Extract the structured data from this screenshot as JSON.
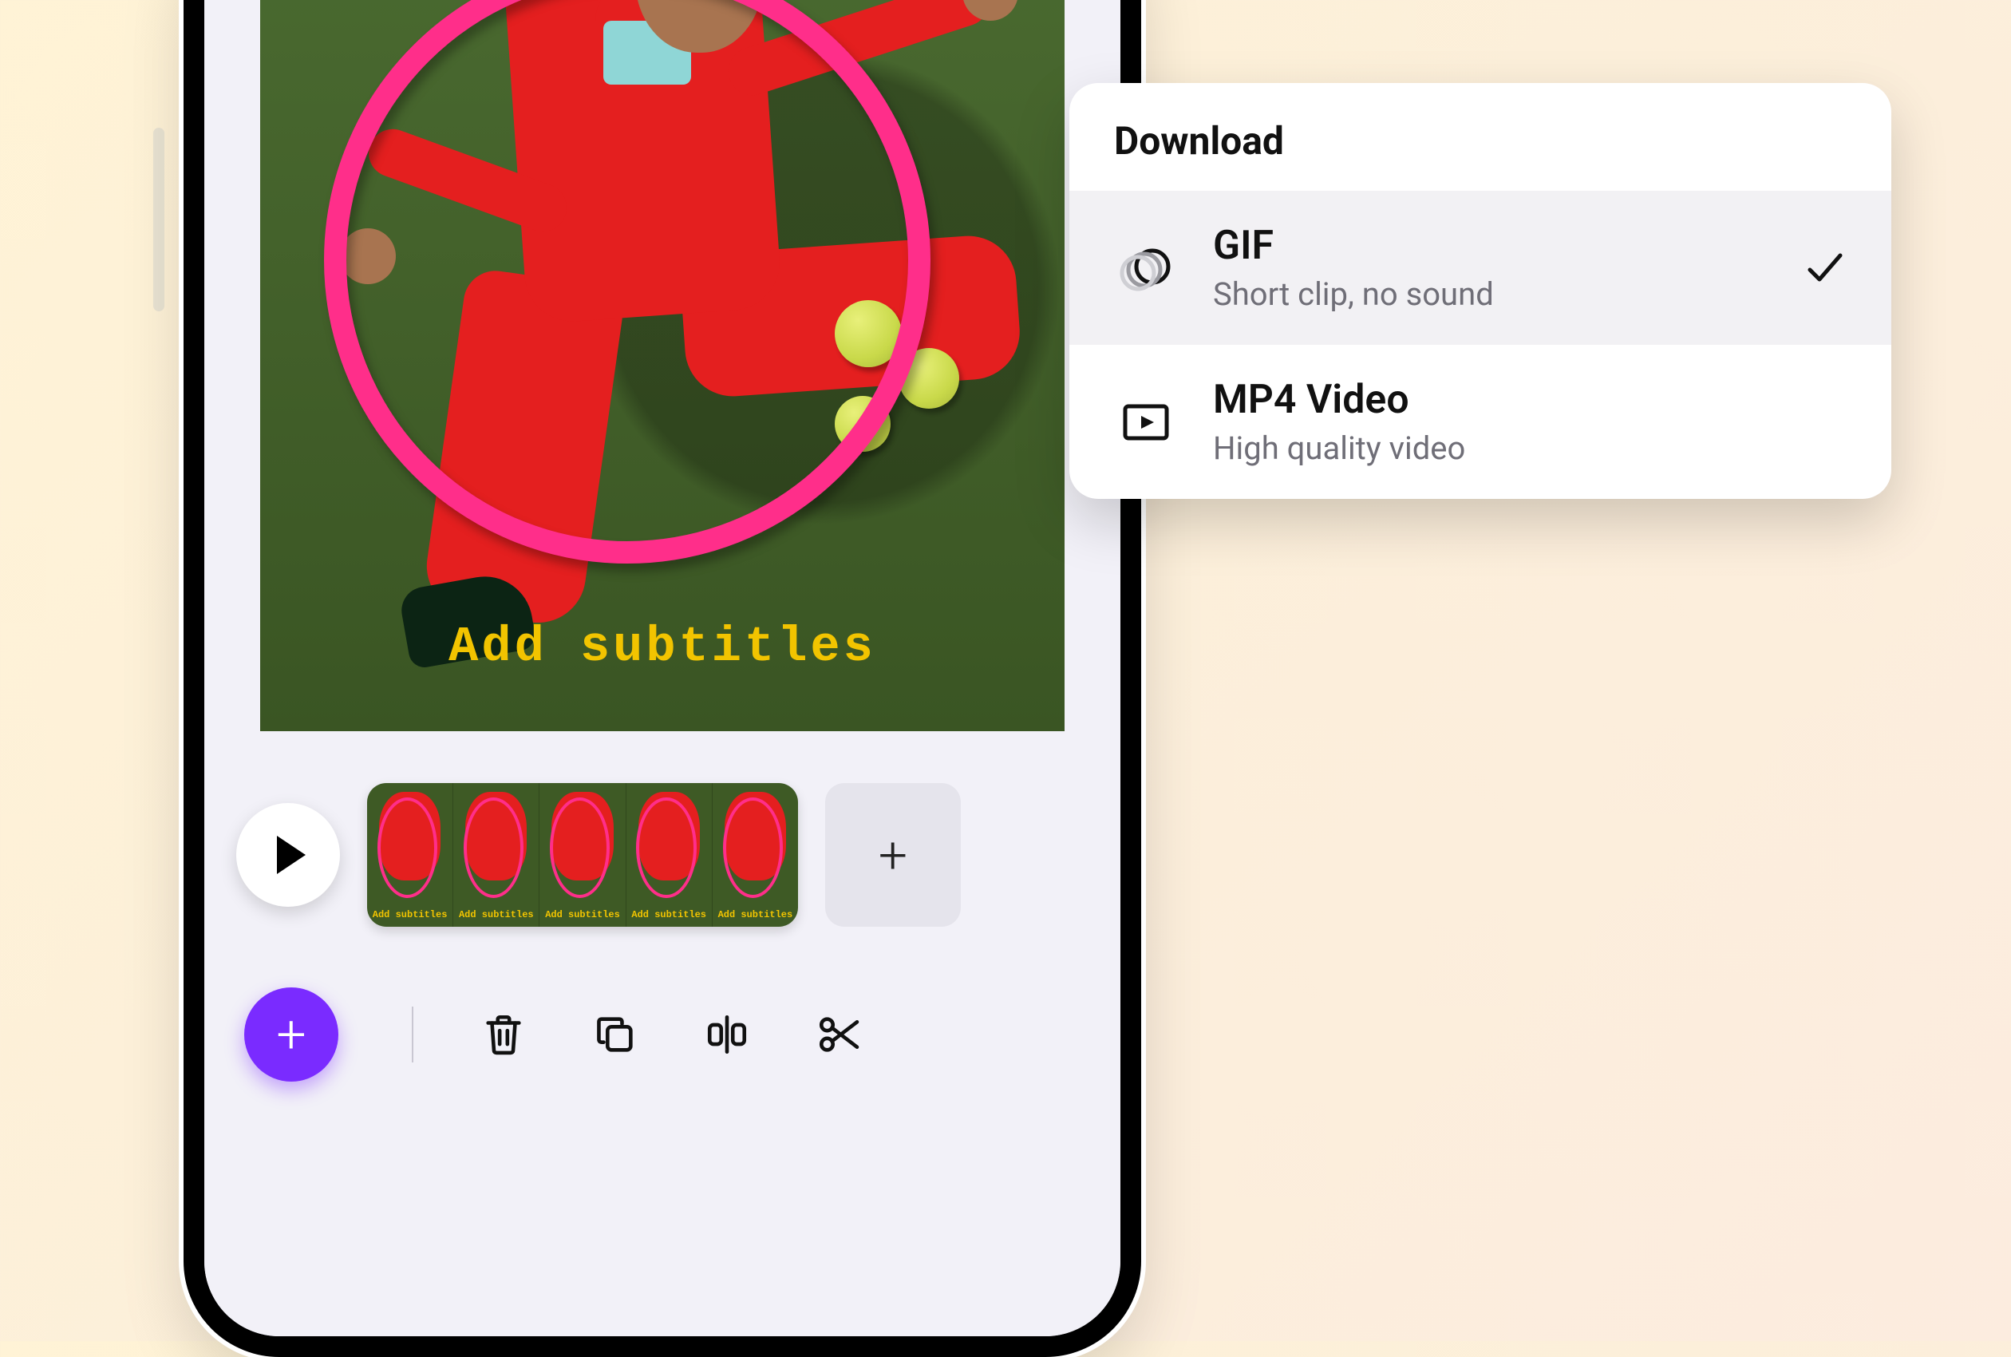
{
  "canvas": {
    "subtitle_overlay": "Add subtitles"
  },
  "timeline": {
    "thumb_label": "Add subtitles",
    "thumb_count": 5
  },
  "download": {
    "title": "Download",
    "options": [
      {
        "label": "GIF",
        "description": "Short clip, no sound",
        "selected": true,
        "icon": "gif-motion-icon"
      },
      {
        "label": "MP4 Video",
        "description": "High quality video",
        "selected": false,
        "icon": "video-file-icon"
      }
    ]
  },
  "toolbar": {
    "fab": "+",
    "add_clip": "+"
  },
  "colors": {
    "accent": "#7a2bff",
    "subtitle": "#f2c400",
    "hoop": "#ff2e8a"
  }
}
